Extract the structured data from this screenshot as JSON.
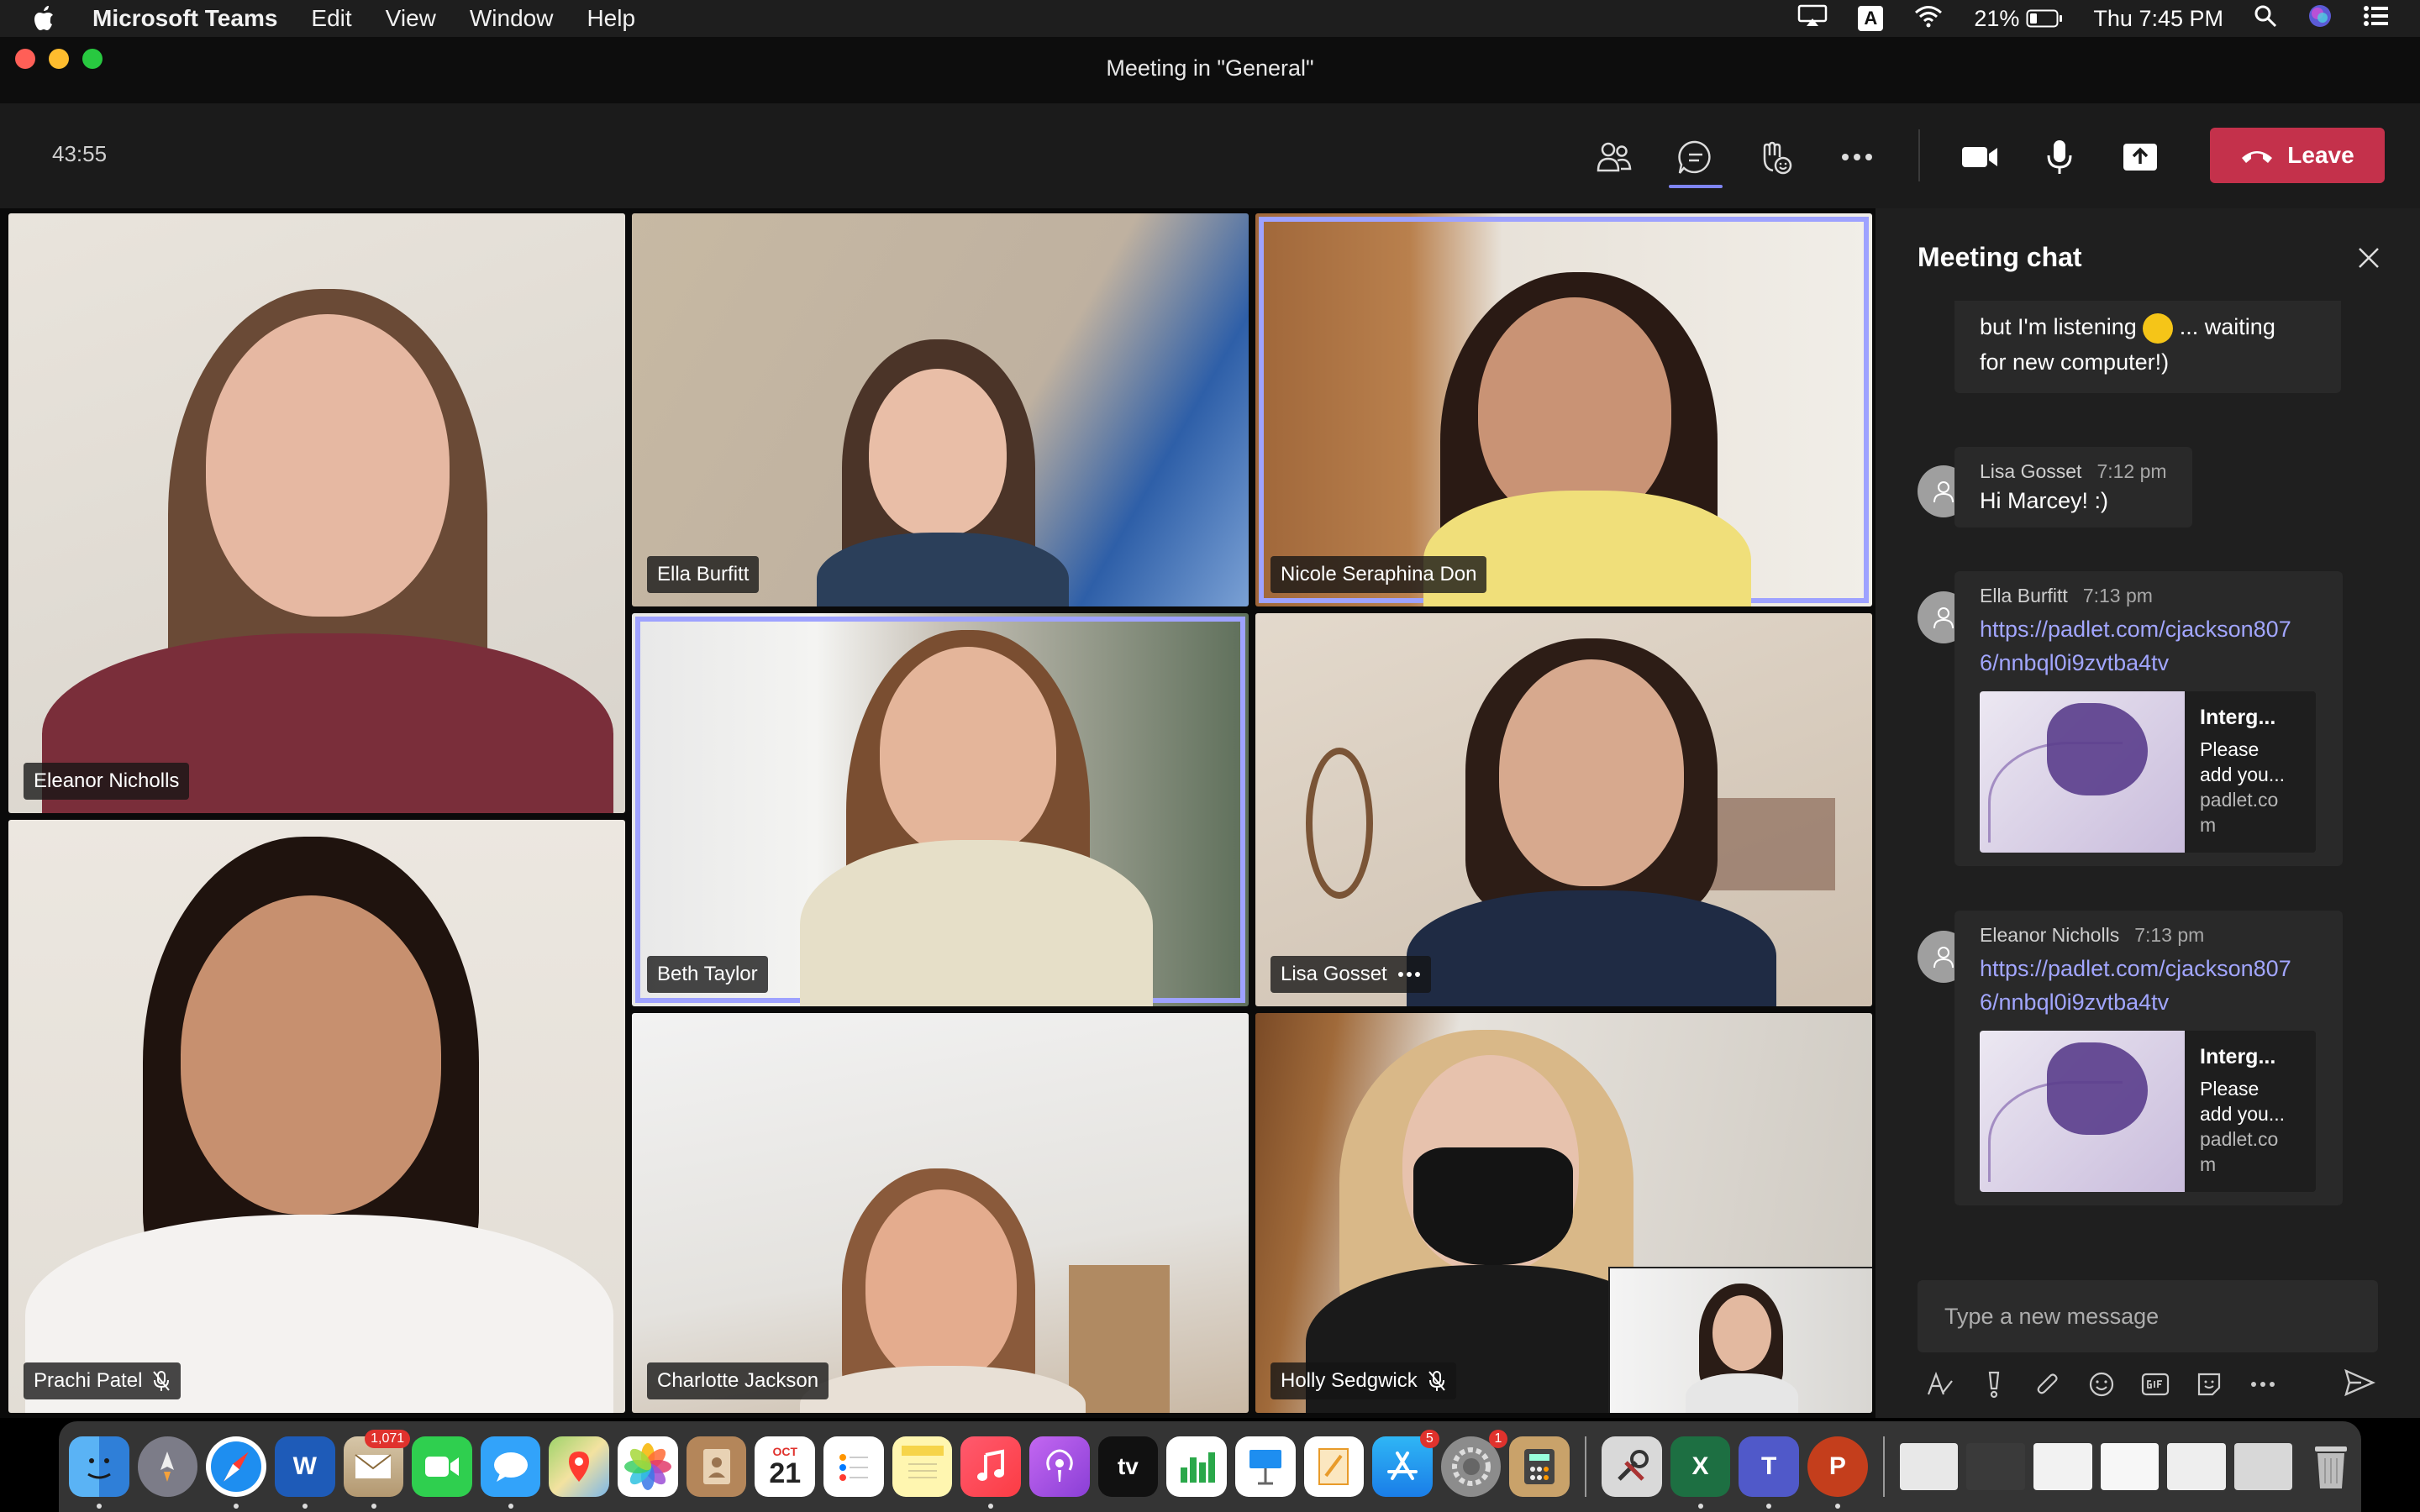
{
  "menubar": {
    "app_name": "Microsoft Teams",
    "menus": [
      "Edit",
      "View",
      "Window",
      "Help"
    ],
    "battery": "21%",
    "clock": "Thu 7:45 PM",
    "input_source": "A"
  },
  "window": {
    "title": "Meeting in \"General\""
  },
  "toolbar": {
    "timer": "43:55",
    "leave_label": "Leave",
    "colors": {
      "leave": "#c4314b",
      "accent": "#7f85f5"
    }
  },
  "participants": [
    {
      "name": "Eleanor Nicholls",
      "muted": false,
      "speaking": false
    },
    {
      "name": "Ella Burfitt",
      "muted": false,
      "speaking": false
    },
    {
      "name": "Nicole Seraphina Don",
      "muted": false,
      "speaking": true
    },
    {
      "name": "Beth Taylor",
      "muted": false,
      "speaking": true
    },
    {
      "name": "Lisa Gosset",
      "muted": false,
      "speaking": false
    },
    {
      "name": "Prachi Patel",
      "muted": true,
      "speaking": false
    },
    {
      "name": "Charlotte Jackson",
      "muted": false,
      "speaking": false
    },
    {
      "name": "Holly Sedgwick",
      "muted": true,
      "speaking": false
    }
  ],
  "chat": {
    "title": "Meeting chat",
    "messages": [
      {
        "text_line1": "but I'm listening",
        "text_emoji": "🙂",
        "text_line1b": "... waiting",
        "text_line2": "for new computer!)"
      },
      {
        "author": "Lisa Gosset",
        "time": "7:12 pm",
        "text": "Hi Marcey! :)"
      },
      {
        "author": "Ella Burfitt",
        "time": "7:13 pm",
        "link_line1": "https://padlet.com/cjackson807",
        "link_line2": "6/nnbql0i9zvtba4tv",
        "card": {
          "title": "Interg...",
          "desc_1": "Please",
          "desc_2": "add you...",
          "domain_1": "padlet.co",
          "domain_2": "m"
        }
      },
      {
        "author": "Eleanor Nicholls",
        "time": "7:13 pm",
        "link_line1": "https://padlet.com/cjackson807",
        "link_line2": "6/nnbql0i9zvtba4tv",
        "card": {
          "title": "Interg...",
          "desc_1": "Please",
          "desc_2": "add you...",
          "domain_1": "padlet.co",
          "domain_2": "m"
        }
      }
    ],
    "compose_placeholder": "Type a new message"
  },
  "dock": {
    "badges": {
      "mail": "1,071",
      "appstore": "5",
      "settings": "1"
    },
    "calendar": {
      "month": "OCT",
      "day": "21"
    },
    "tv_label": "tv"
  }
}
